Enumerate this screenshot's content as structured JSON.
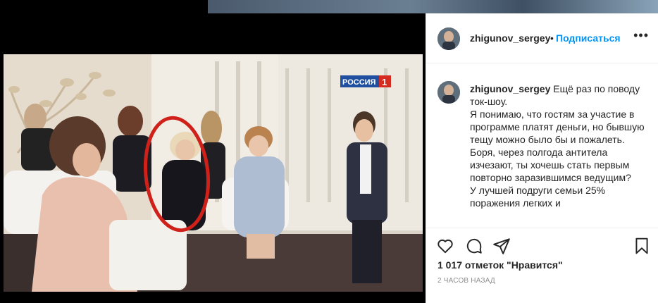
{
  "post": {
    "channel_logo_text": "РОССИЯ",
    "channel_logo_number": "1"
  },
  "header": {
    "username": "zhigunov_sergey",
    "separator": "•",
    "follow_label": "Подписаться",
    "more_label": "•••"
  },
  "caption": {
    "username": "zhigunov_sergey",
    "lines": [
      "Ещё раз по поводу ток-шоу.",
      "Я понимаю, что гостям за участие в программе платят деньги, но бывшую тещу можно было бы и пожалеть.",
      "Боря, через полгода антитела изчезают, ты хочешь стать первым повторно заразившимся ведущим?",
      "У лучшей подруги семьи 25% поражения легких и"
    ]
  },
  "actions": {
    "icons": [
      "heart-icon",
      "comment-icon",
      "share-icon",
      "bookmark-icon"
    ],
    "likes_text": "1 017 отметок \"Нравится\"",
    "time_text": "2 ЧАСОВ НАЗАД"
  },
  "colors": {
    "link": "#0095f6",
    "text": "#262626",
    "muted": "#8e8e8e",
    "highlight_circle": "#d0201a",
    "logo_blue": "#1f4f9e",
    "logo_red": "#d42a1f"
  }
}
